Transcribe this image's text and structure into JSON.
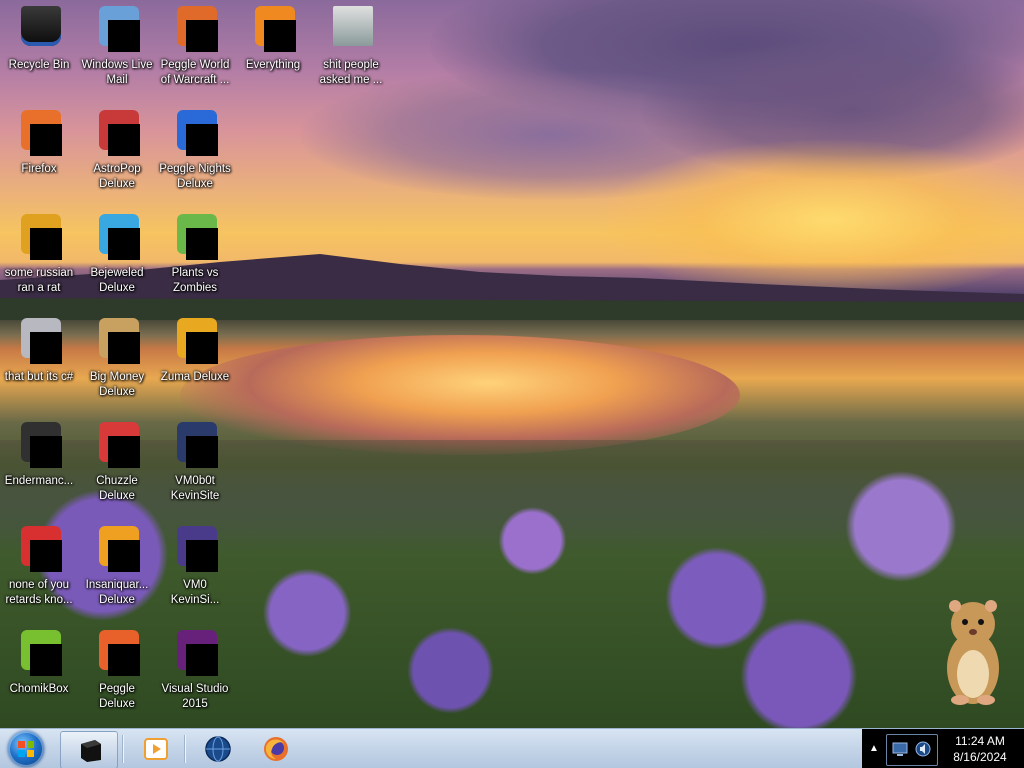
{
  "desktop": {
    "icons": [
      {
        "label": "Recycle Bin",
        "icon": "recycle-bin-icon",
        "color": "#1a1a1a"
      },
      {
        "label": "Windows Live Mail",
        "icon": "mail-icon",
        "color": "#6aa0d8"
      },
      {
        "label": "Peggle World of Warcraft ...",
        "icon": "peggle-icon",
        "color": "#e06a2a"
      },
      {
        "label": "Everything",
        "icon": "search-icon",
        "color": "#f08a20"
      },
      {
        "label": "shit people asked me ...",
        "icon": "folder-icon",
        "color": "#3a4a4a"
      },
      {
        "label": "Firefox",
        "icon": "firefox-icon",
        "color": "#e8702a"
      },
      {
        "label": "AstroPop Deluxe",
        "icon": "astropop-icon",
        "color": "#c83a3a"
      },
      {
        "label": "Peggle Nights Deluxe",
        "icon": "peggle-icon",
        "color": "#2a6ad8"
      },
      {
        "label": "some russian ran a rat",
        "icon": "app-icon",
        "color": "#e0a020"
      },
      {
        "label": "Bejeweled Deluxe",
        "icon": "bejeweled-icon",
        "color": "#3aa8e0"
      },
      {
        "label": "Plants vs Zombies",
        "icon": "plant-icon",
        "color": "#6ab84a"
      },
      {
        "label": "that but its c#",
        "icon": "window-icon",
        "color": "#b8b8c0"
      },
      {
        "label": "Big Money Deluxe",
        "icon": "money-bag-icon",
        "color": "#c8a060"
      },
      {
        "label": "Zuma Deluxe",
        "icon": "zuma-icon",
        "color": "#e8a820"
      },
      {
        "label": "Endermanc...",
        "icon": "terminal-icon",
        "color": "#303030"
      },
      {
        "label": "Chuzzle Deluxe",
        "icon": "chuzzle-icon",
        "color": "#d83a3a"
      },
      {
        "label": "VM0b0t KevinSite",
        "icon": "monitor-icon",
        "color": "#2a3a6a"
      },
      {
        "label": "none of you retards kno...",
        "icon": "opera-icon",
        "color": "#d83030"
      },
      {
        "label": "Insaniquar... Deluxe",
        "icon": "fish-icon",
        "color": "#f0a020"
      },
      {
        "label": "VM0 KevinSi...",
        "icon": "shield-icon",
        "color": "#4a3a8a"
      },
      {
        "label": "ChomikBox",
        "icon": "chomikbox-icon",
        "color": "#78c030"
      },
      {
        "label": "Peggle Deluxe",
        "icon": "peggle-icon",
        "color": "#e8602a"
      },
      {
        "label": "Visual Studio 2015",
        "icon": "visual-studio-icon",
        "color": "#68217a"
      }
    ]
  },
  "taskbar": {
    "items": [
      {
        "name": "app-window",
        "icon": "black-box-icon",
        "color": "#111111"
      },
      {
        "name": "media-player",
        "icon": "media-player-icon",
        "color": "#f0a030"
      },
      {
        "name": "globe-app",
        "icon": "globe-icon",
        "color": "#1a4a8a"
      },
      {
        "name": "firefox",
        "icon": "firefox-icon",
        "color": "#e8702a"
      }
    ]
  },
  "tray": {
    "time": "11:24 AM",
    "date": "8/16/2024",
    "overflow_arrow": "▲"
  }
}
